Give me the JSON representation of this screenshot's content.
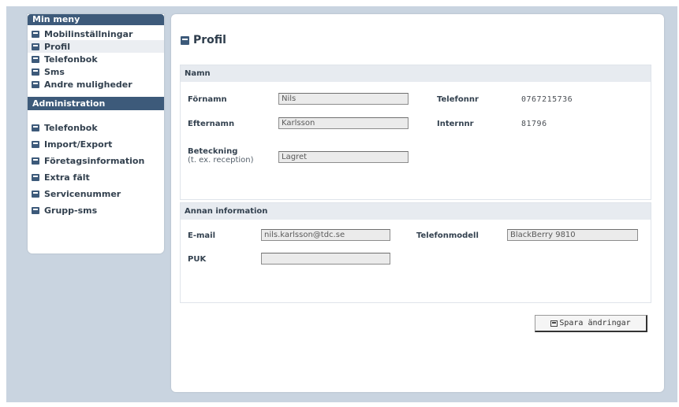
{
  "sidebar": {
    "menu_header": "Min meny",
    "menu_items": [
      {
        "label": "Mobilinställningar",
        "icon": "settings-icon"
      },
      {
        "label": "Profil",
        "icon": "profile-icon"
      },
      {
        "label": "Telefonbok",
        "icon": "phonebook-icon"
      },
      {
        "label": "Sms",
        "icon": "sms-icon"
      },
      {
        "label": "Andre muligheder",
        "icon": "info-icon"
      }
    ],
    "admin_header": "Administration",
    "admin_items": [
      {
        "label": "Telefonbok",
        "icon": "phonebook-icon"
      },
      {
        "label": "Import/Export",
        "icon": "import-export-icon"
      },
      {
        "label": "Företagsinformation",
        "icon": "company-icon"
      },
      {
        "label": "Extra fält",
        "icon": "extra-field-icon"
      },
      {
        "label": "Servicenummer",
        "icon": "service-icon"
      },
      {
        "label": "Grupp-sms",
        "icon": "group-sms-icon"
      }
    ]
  },
  "main": {
    "title": "Profil",
    "name_section": {
      "header": "Namn",
      "first_name_label": "Förnamn",
      "first_name_value": "Nils",
      "last_name_label": "Efternamn",
      "last_name_value": "Karlsson",
      "designation_label": "Beteckning",
      "designation_hint": "(t. ex. reception)",
      "designation_value": "Lagret",
      "phone_label": "Telefonnr",
      "phone_value": "0767215736",
      "internal_label": "Internnr",
      "internal_value": "81796"
    },
    "other_section": {
      "header": "Annan information",
      "email_label": "E-mail",
      "email_value": "nils.karlsson@tdc.se",
      "puk_label": "PUK",
      "puk_value": "",
      "model_label": "Telefonmodell",
      "model_value": "BlackBerry 9810"
    },
    "save_label": "Spara ändringar"
  },
  "colors": {
    "accent": "#3d5a7a",
    "background": "#c9d4e0",
    "section_header": "#e7ebf0"
  }
}
